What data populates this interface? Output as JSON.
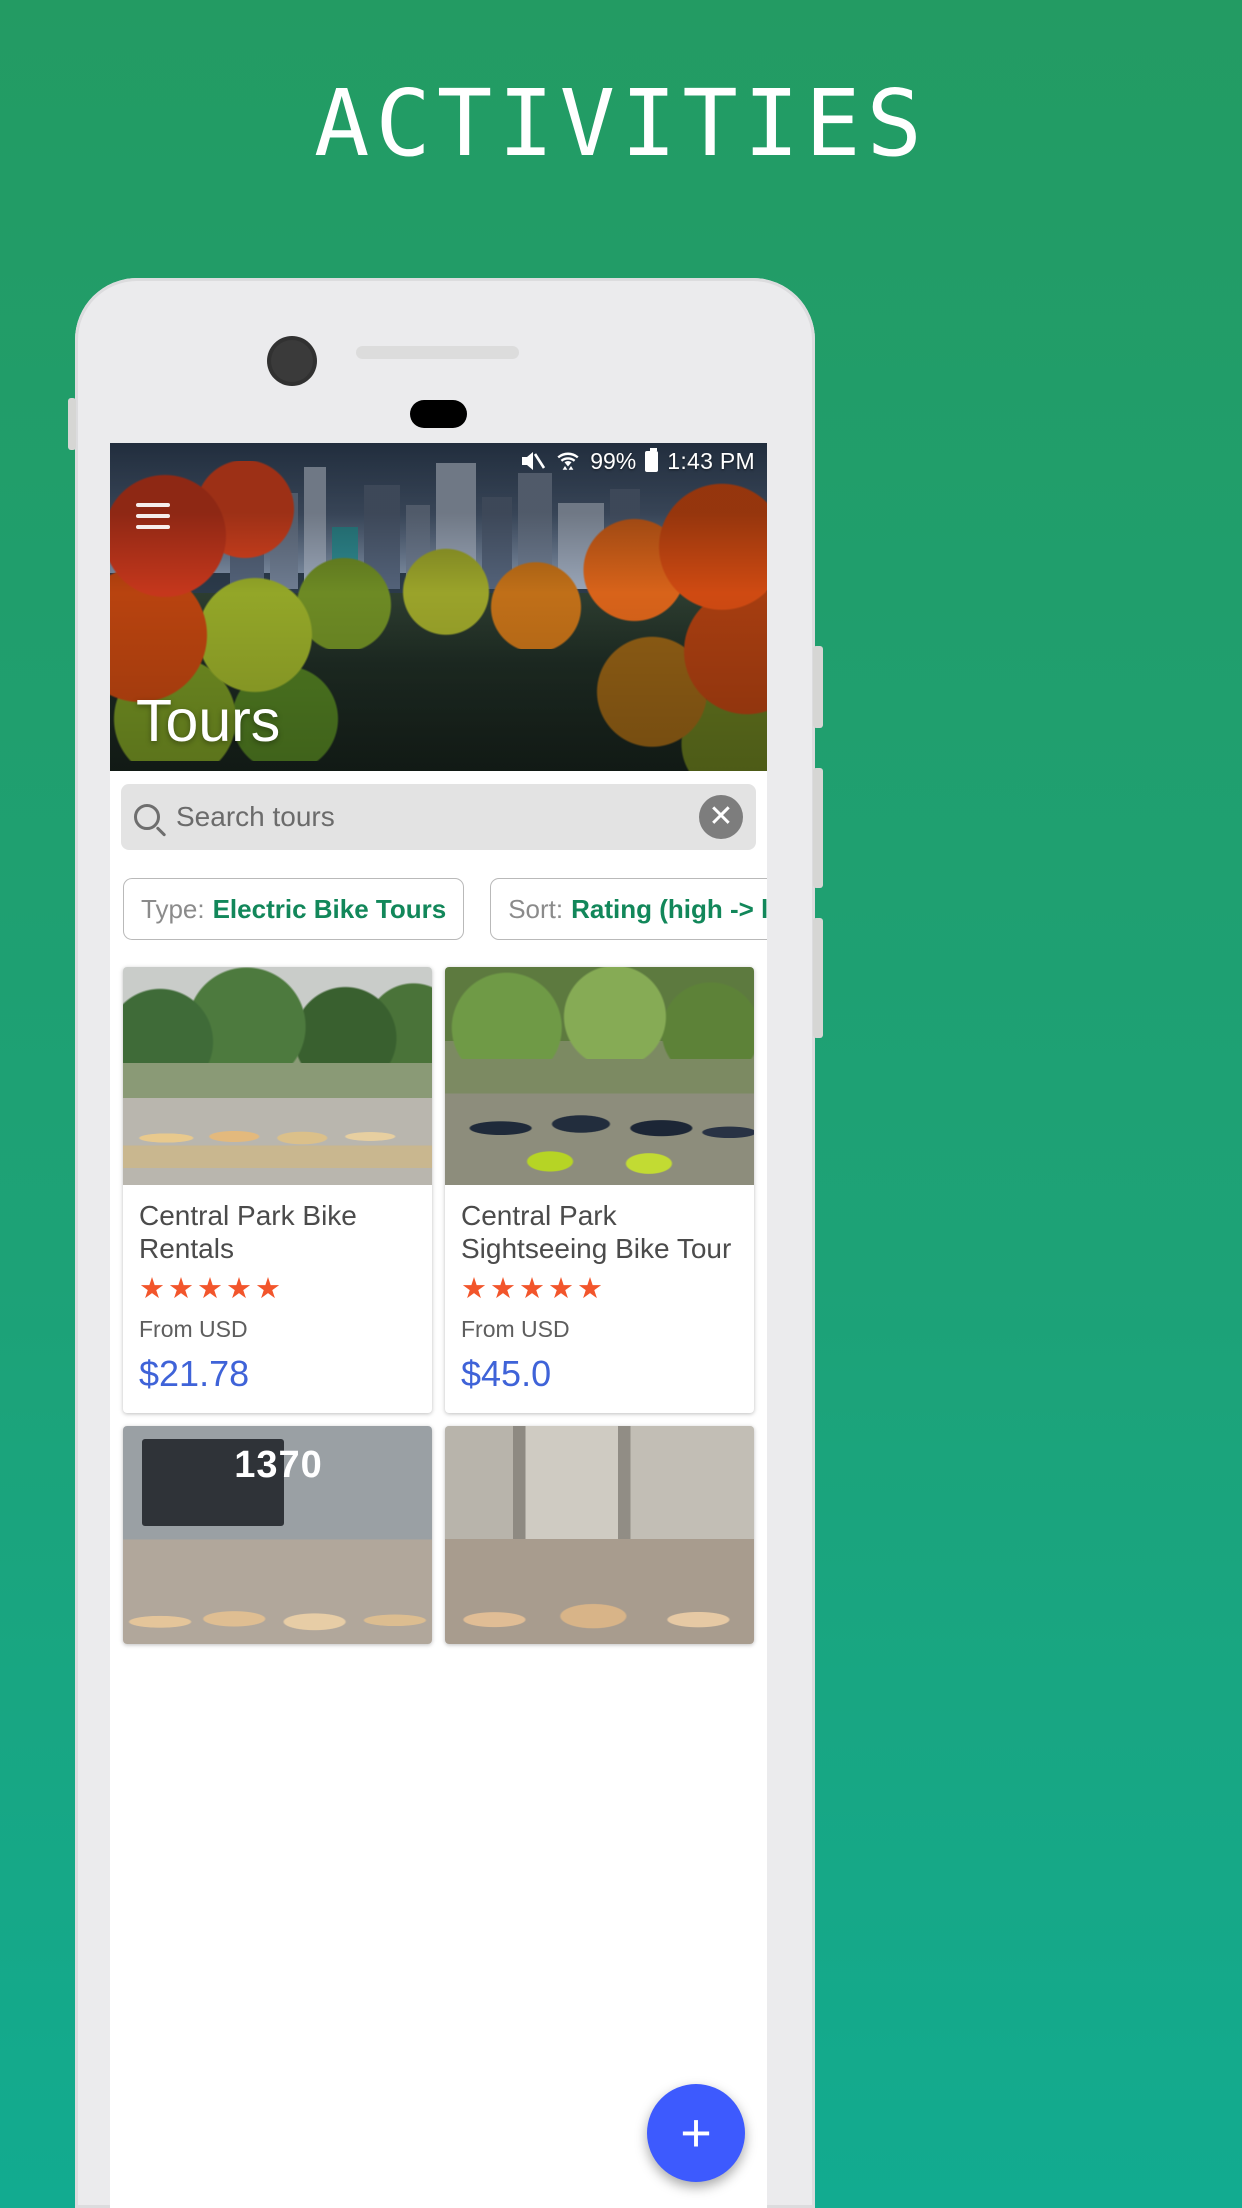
{
  "promo": {
    "title": "ACTIVITIES"
  },
  "statusbar": {
    "mute_icon": "volume-mute-icon",
    "wifi_icon": "wifi-icon",
    "battery_percent": "99%",
    "battery_icon": "battery-full-icon",
    "time": "1:43 PM"
  },
  "appbar": {
    "menu_icon": "hamburger-menu-icon",
    "title": "Tours"
  },
  "search": {
    "icon": "search-icon",
    "placeholder": "Search tours",
    "value": "",
    "clear_icon": "✕"
  },
  "filters": [
    {
      "label": "Type:",
      "value": "Electric Bike Tours",
      "name": "filter-chip-type"
    },
    {
      "label": "Sort:",
      "value": "Rating (high -> low)",
      "name": "filter-chip-sort"
    }
  ],
  "cards": [
    {
      "title": "Central Park Bike Rentals",
      "stars": "★★★★★",
      "rating": 5,
      "from_label": "From USD",
      "price": "$21.78",
      "image": "women-with-yellow-bikes-in-park"
    },
    {
      "title": "Central Park Sightseeing Bike Tour",
      "stars": "★★★★★",
      "rating": 5,
      "from_label": "From USD",
      "price": "$45.0",
      "image": "tour-group-with-green-bikes"
    },
    {
      "title": "",
      "stars": "",
      "rating": 0,
      "from_label": "",
      "price": "",
      "image": "storefront-1370-group-photo",
      "image_label": "1370"
    },
    {
      "title": "",
      "stars": "",
      "rating": 0,
      "from_label": "",
      "price": "",
      "image": "street-group-photo"
    }
  ],
  "fab": {
    "label": "+",
    "icon": "plus-icon"
  },
  "colors": {
    "brand_green": "#219a62",
    "accent_green": "#12875a",
    "price_blue": "#3f63d8",
    "star_orange": "#f2552b",
    "fab_blue": "#3d5afe"
  }
}
